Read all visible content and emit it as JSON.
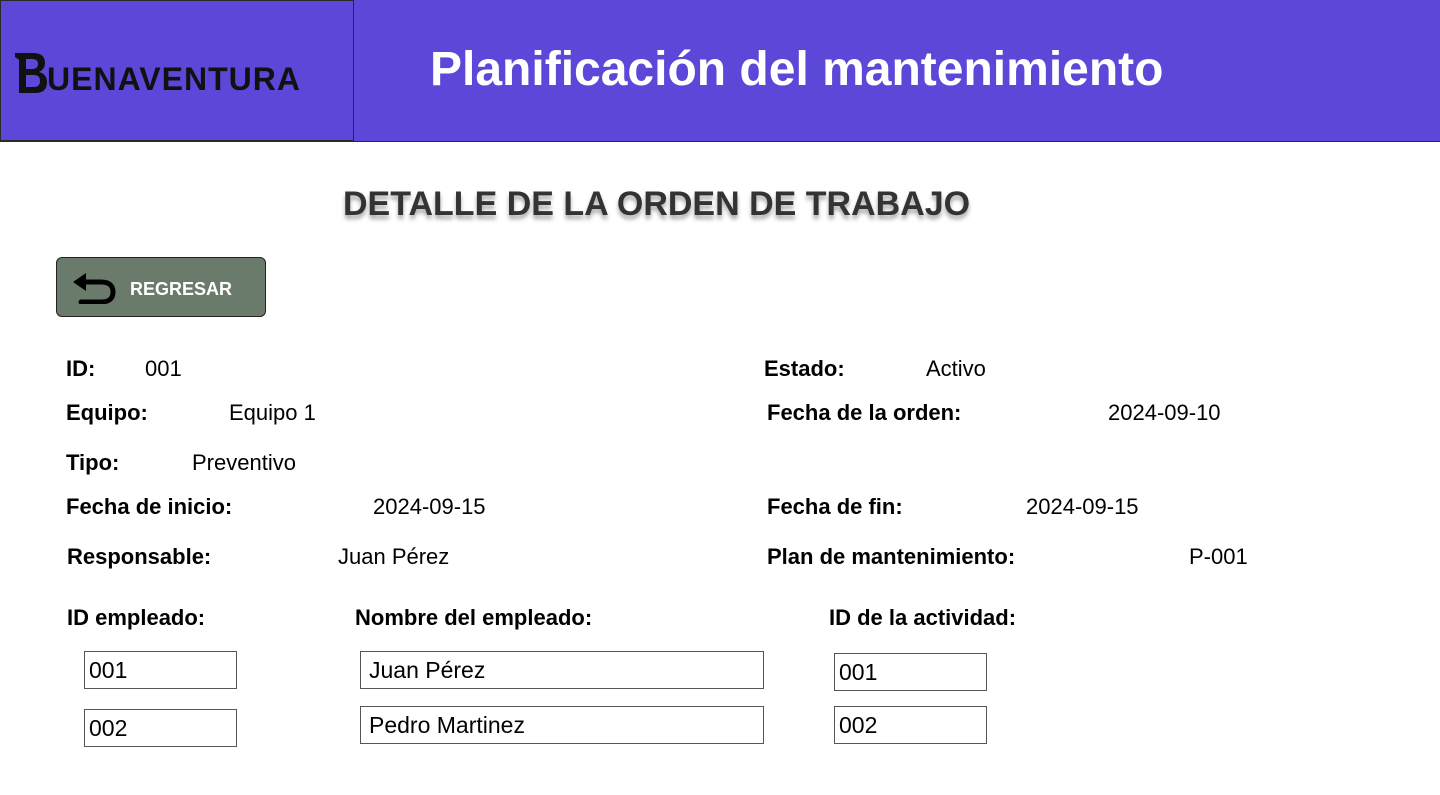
{
  "header": {
    "logo_text": "UENAVENTURA",
    "app_title": "Planificación del mantenimiento"
  },
  "page": {
    "title": "DETALLE DE LA ORDEN DE TRABAJO",
    "back_label": "REGRESAR"
  },
  "order": {
    "id_label": "ID:",
    "id_value": "001",
    "estado_label": "Estado:",
    "estado_value": "Activo",
    "equipo_label": "Equipo:",
    "equipo_value": "Equipo 1",
    "fecha_orden_label": "Fecha de la orden:",
    "fecha_orden_value": "2024-09-10",
    "tipo_label": "Tipo:",
    "tipo_value": "Preventivo",
    "fecha_inicio_label": "Fecha de inicio:",
    "fecha_inicio_value": "2024-09-15",
    "fecha_fin_label": "Fecha de fin:",
    "fecha_fin_value": "2024-09-15",
    "responsable_label": "Responsable:",
    "responsable_value": "Juan Pérez",
    "plan_label": "Plan de mantenimiento:",
    "plan_value": "P-001"
  },
  "employees": {
    "headers": [
      "ID empleado:",
      "Nombre del empleado:",
      "ID de la actividad:"
    ],
    "rows": [
      {
        "id": "001",
        "name": "Juan Pérez",
        "activity": "001"
      },
      {
        "id": "002",
        "name": "Pedro Martinez",
        "activity": "002"
      }
    ]
  },
  "colors": {
    "header_bg": "#5b47d8",
    "back_button_bg": "#6b7b6b"
  },
  "icons": {
    "logo": "buenaventura-logo-icon",
    "back": "undo-arrow-icon"
  }
}
